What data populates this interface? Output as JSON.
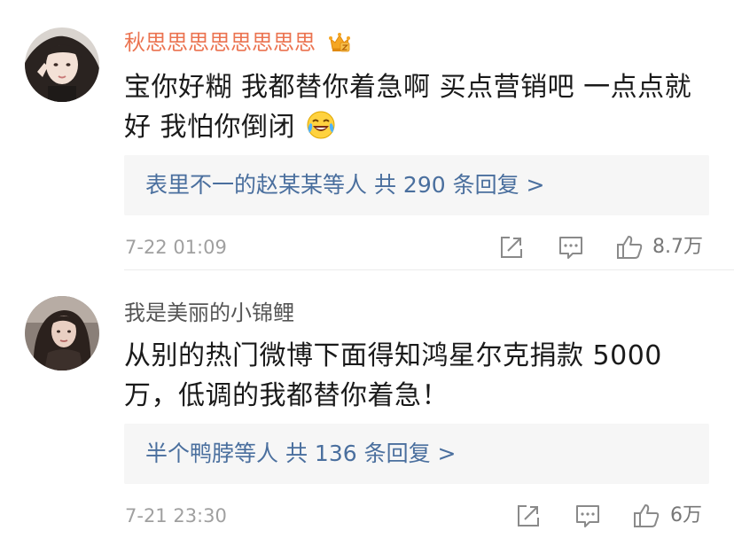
{
  "comments": [
    {
      "username": "秋思思思思思思思思",
      "badge_icon": "crown-icon",
      "content": "宝你好糊 我都替你着急啊 买点营销吧 一点点就好 我怕你倒闭",
      "content_emoji": "laugh-cry-icon",
      "replies": {
        "users": "表里不一的赵某某等人",
        "summary": "共 290 条回复 >"
      },
      "timestamp": "7-22 01:09",
      "likes": "8.7万",
      "actions": [
        "share-icon",
        "comment-icon",
        "like-icon"
      ]
    },
    {
      "username": "我是美丽的小锦鲤",
      "content": "从别的热门微博下面得知鸿星尔克捐款 5000 万，低调的我都替你着急！",
      "replies": {
        "users": "半个鸭脖等人",
        "summary": "共 136 条回复 >"
      },
      "timestamp": "7-21 23:30",
      "likes": "6万",
      "actions": [
        "share-icon",
        "comment-icon",
        "like-icon"
      ]
    }
  ],
  "colors": {
    "vip_username": "#eb7350",
    "username": "#555555",
    "link": "#4a6f9e",
    "meta": "#a0a0a0",
    "reply_bg": "#f6f6f6"
  }
}
